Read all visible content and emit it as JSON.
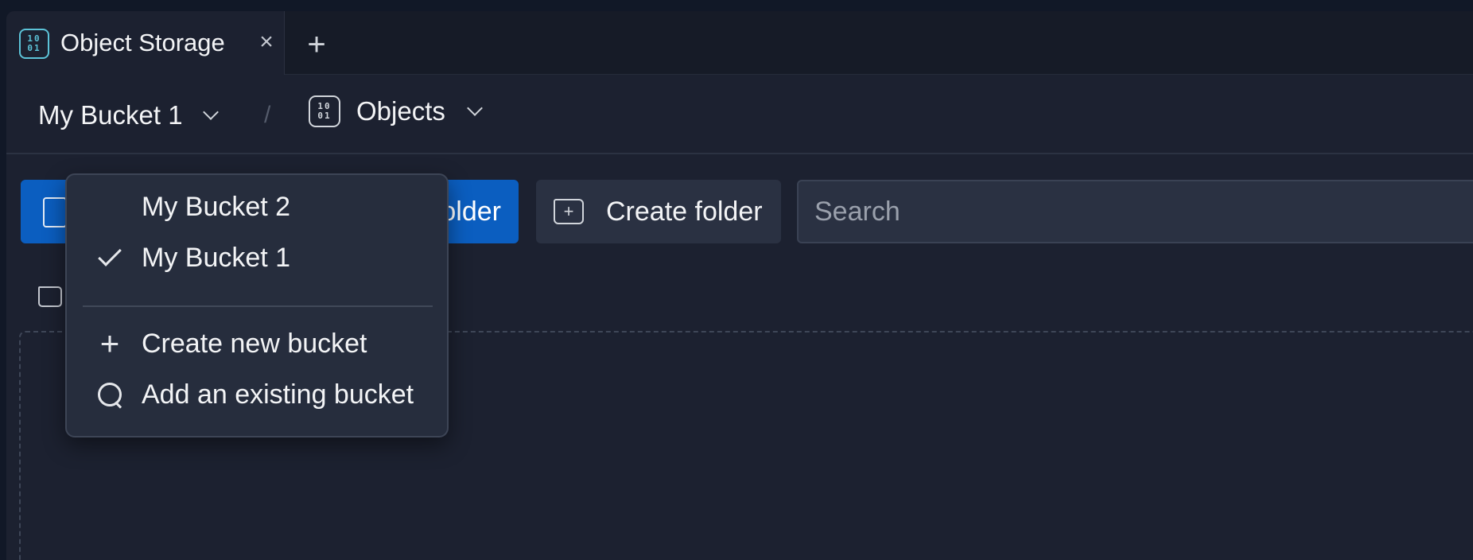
{
  "tab": {
    "title": "Object Storage",
    "icon": "binary-storage-icon",
    "close_glyph": "×",
    "new_tab_glyph": "+"
  },
  "breadcrumb": {
    "bucket": "My Bucket 1",
    "separator": "/",
    "section": "Objects",
    "section_icon": "binary-storage-icon"
  },
  "toolbar": {
    "upload_label": "Upload folder",
    "create_folder_label": "Create folder",
    "search_placeholder": "Search"
  },
  "bucket_menu": {
    "items": [
      {
        "label": "My Bucket 2",
        "icon": "",
        "selected": false
      },
      {
        "label": "My Bucket 1",
        "icon": "check-icon",
        "selected": true
      }
    ],
    "actions": [
      {
        "label": "Create new bucket",
        "icon": "plus-icon"
      },
      {
        "label": "Add an existing bucket",
        "icon": "search-icon"
      }
    ]
  },
  "colors": {
    "accent": "#0b5ec0",
    "storage_icon": "#5cc3d8",
    "background": "#1c2130"
  }
}
